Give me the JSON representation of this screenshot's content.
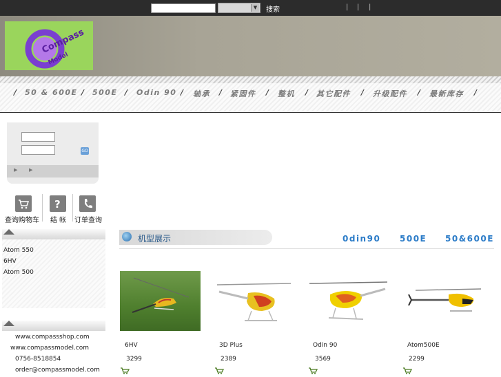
{
  "topbar": {
    "search_value": "",
    "search_button": "搜索",
    "separators": [
      "|",
      "|",
      "|"
    ]
  },
  "logo": {
    "brand": "Compass",
    "sub": "Model"
  },
  "nav": {
    "items": [
      "50 & 600E",
      "500E",
      "Odin 90",
      "轴承",
      "紧固件",
      "整机",
      "其它配件",
      "升级配件",
      "最新库存"
    ]
  },
  "login": {
    "username": "",
    "password": "",
    "go_label": "GO"
  },
  "quick_links": [
    {
      "label": "查询购物车",
      "icon": "cart-icon"
    },
    {
      "label": "结 帐",
      "icon": "question-icon"
    },
    {
      "label": "订单查询",
      "icon": "phone-icon"
    }
  ],
  "sidebar": {
    "models": [
      "Atom 550",
      "6HV",
      "Atom 500"
    ],
    "contacts": [
      "www.compassshop.com",
      "www.compassmodel.com",
      "0756-8518854",
      "order@compassmodel.com"
    ]
  },
  "main": {
    "title": "机型展示",
    "tabs": [
      "0din90",
      "500E",
      "50&600E"
    ],
    "products": [
      {
        "name": "6HV",
        "price": "3299"
      },
      {
        "name": "3D Plus",
        "price": "2389"
      },
      {
        "name": "Odin 90",
        "price": "3569"
      },
      {
        "name": "Atom500E",
        "price": "2299"
      }
    ]
  },
  "colors": {
    "accent": "#2c7cc8",
    "topbar": "#2c2c2c",
    "logo_bg": "#9ad55c",
    "logo_ring": "#7a3fd0"
  }
}
